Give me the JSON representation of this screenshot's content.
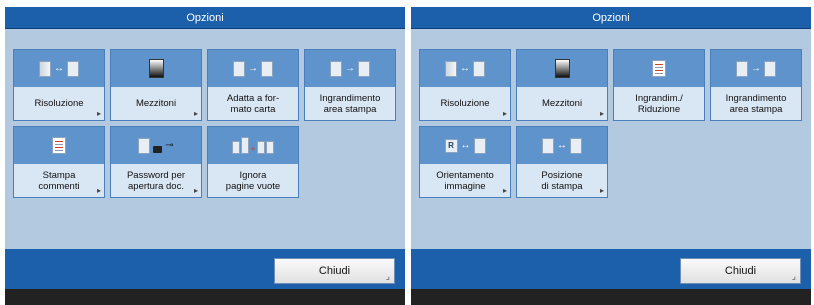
{
  "left_panel": {
    "title": "Opzioni",
    "tiles": [
      {
        "label": "Risoluzione",
        "icon": "resolution-icon"
      },
      {
        "label": "Mezzitoni",
        "icon": "halftones-icon"
      },
      {
        "label": "Adatta a for-\nmato carta",
        "icon": "fit-paper-size-icon"
      },
      {
        "label": "Ingrandimento\narea stampa",
        "icon": "enlarge-print-area-icon"
      },
      {
        "label": "Stampa\ncommenti",
        "icon": "print-comments-icon"
      },
      {
        "label": "Password per\napertura doc.",
        "icon": "document-password-icon"
      },
      {
        "label": "Ignora\npagine vuote",
        "icon": "skip-blank-pages-icon"
      }
    ],
    "close_label": "Chiudi"
  },
  "right_panel": {
    "title": "Opzioni",
    "tiles": [
      {
        "label": "Risoluzione",
        "icon": "resolution-icon"
      },
      {
        "label": "Mezzitoni",
        "icon": "halftones-icon"
      },
      {
        "label": "Ingrandim./\nRiduzione",
        "icon": "zoom-reduce-icon"
      },
      {
        "label": "Ingrandimento\narea stampa",
        "icon": "enlarge-print-area-icon"
      },
      {
        "label": "Orientamento\nimmagine",
        "icon": "image-orientation-icon"
      },
      {
        "label": "Posizione\ndi stampa",
        "icon": "print-position-icon"
      }
    ],
    "close_label": "Chiudi"
  },
  "colors": {
    "title_bar": "#1c5fab",
    "panel_bg": "#b3c9df",
    "tile_icon_bg": "#5f93cc",
    "tile_label_bg": "#d9e6f3",
    "footer": "#222222"
  }
}
